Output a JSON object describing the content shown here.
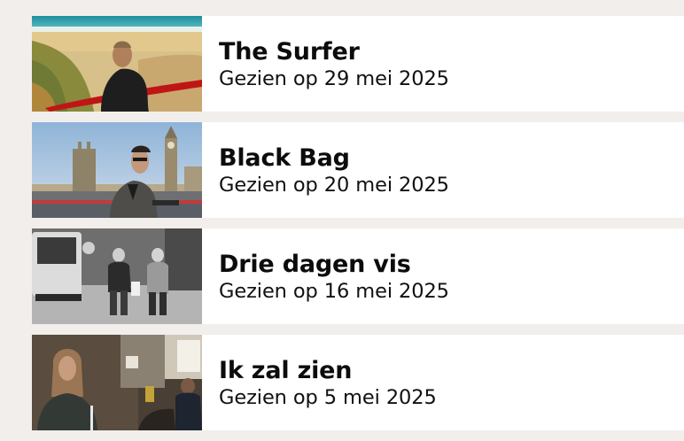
{
  "watched": {
    "items": [
      {
        "title": "The Surfer",
        "date": "Gezien op 29 mei 2025",
        "thumbnail": "surfer-thumbnail"
      },
      {
        "title": "Black Bag",
        "date": "Gezien op 20 mei 2025",
        "thumbnail": "black-bag-thumbnail"
      },
      {
        "title": "Drie dagen vis",
        "date": "Gezien op 16 mei 2025",
        "thumbnail": "drie-dagen-vis-thumbnail"
      },
      {
        "title": "Ik zal zien",
        "date": "Gezien op 5 mei 2025",
        "thumbnail": "ik-zal-zien-thumbnail"
      }
    ]
  },
  "colors": {
    "background": "#f1eeec",
    "card": "#ffffff",
    "text": "#0c0c0c"
  }
}
